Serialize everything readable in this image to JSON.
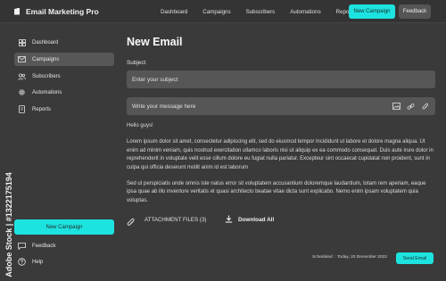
{
  "app": {
    "name": "Email Marketing Pro"
  },
  "topnav": {
    "items": [
      "Dashboard",
      "Campaigns",
      "Subscribers",
      "Automations",
      "Reports"
    ],
    "new_campaign": "New Campaign",
    "feedback": "Feedback"
  },
  "sidebar": {
    "items": [
      {
        "label": "Dashboard",
        "icon": "grid-icon",
        "active": false
      },
      {
        "label": "Campaigns",
        "icon": "envelope-icon",
        "active": true
      },
      {
        "label": "Subscribers",
        "icon": "users-icon",
        "active": false
      },
      {
        "label": "Automations",
        "icon": "gear-icon",
        "active": false
      },
      {
        "label": "Reports",
        "icon": "document-icon",
        "active": false
      }
    ],
    "new_campaign": "New Campaign",
    "footer_items": [
      {
        "label": "Feedback",
        "icon": "feedback-icon"
      },
      {
        "label": "Help",
        "icon": "help-icon"
      }
    ]
  },
  "main": {
    "title": "New Email",
    "subject_label": "Subject",
    "subject_placeholder": "Enter your subject",
    "message_placeholder": "Write your message here",
    "greeting": "Hello guys!",
    "paragraph1": "Lorem ipsum dolor sit amet, consectetur adipiscing elit, sed do eiusmod tempor incididunt ut labore et dolore magna aliqua. Ut enim ad minim veniam, quis nostrud exercitation ullamco laboris nisi ut aliquip ex ea commodo consequat. Duis aute irure dolor in reprehenderit in voluptate velit esse cillum dolore eu fugiat nulla pariatur. Excepteur sint occaecat cupidatat non proident, sunt in culpa qui officia deserunt mollit anim id est laborum",
    "paragraph2": "Sed ut perspiciatis unde omnis iste natus error sit voluptatem accusantium doloremque laudantium, totam rem aperiam, eaque ipsa quae ab illo inventore veritatis et quasi architecto beatae vitae dicta sunt explicabo. Nemo enim ipsam voluptatem quia voluptas.",
    "attachments_label": "ATTACHMENT FILES (3)",
    "download_label": "Download All",
    "scheduled_label": "Scheduled",
    "scheduled_sep": ":",
    "scheduled_date": "Today, 20 December 2022",
    "send_label": "Send Email"
  },
  "side_text": "Adobe Stock | #1322175194",
  "colors": {
    "accent": "#1de3e0",
    "background": "#3a3a3a",
    "input": "#565656",
    "active_nav": "#575757"
  }
}
